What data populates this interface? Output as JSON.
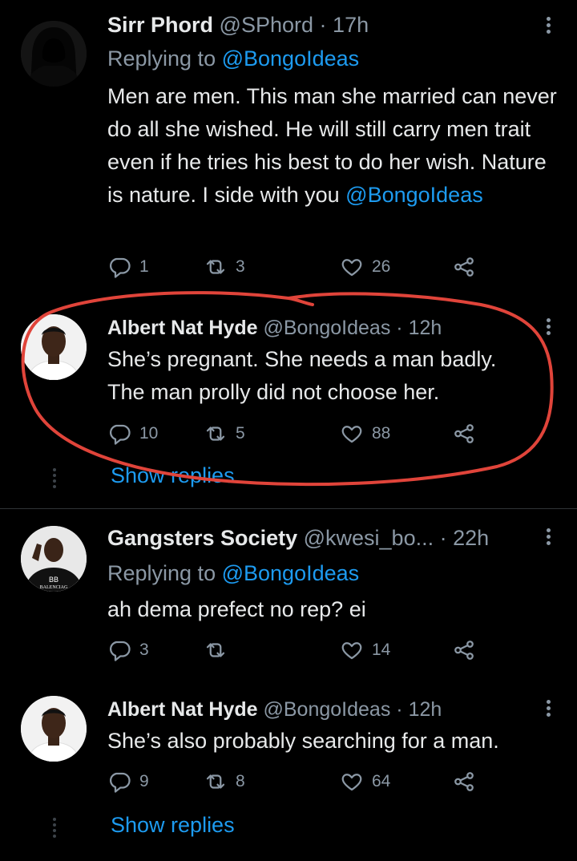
{
  "tweets": [
    {
      "name": "Sirr Phord",
      "handle": "@SPhord",
      "dot": "·",
      "time": "17h",
      "replying_prefix": "Replying to",
      "replying_handle": "@BongoIdeas",
      "text": "Men are men. This man she married can never do all she wished. He will still carry men trait even if he tries his best to do her wish. Nature is nature. I side with you",
      "text_mention": "@BongoIdeas",
      "replies": "1",
      "retweets": "3",
      "likes": "26",
      "avatar_icon": "hooded-figure-icon"
    },
    {
      "name": "Albert Nat Hyde",
      "handle": "@BongoIdeas",
      "dot": "·",
      "time": "12h",
      "text_line1": "She’s pregnant. She needs a man badly.",
      "text_line2": "The man prolly did not choose her.",
      "replies": "10",
      "retweets": "5",
      "likes": "88",
      "show_replies": "Show replies",
      "highlight_color": "#e0443a"
    },
    {
      "name": "Gangsters Society",
      "handle": "@kwesi_bo...",
      "dot": "·",
      "time": "22h",
      "replying_prefix": "Replying to",
      "replying_handle": "@BongoIdeas",
      "text": "ah dema prefect no rep? ei",
      "replies": "3",
      "retweets": "",
      "likes": "14",
      "avatar_text_top": "BB",
      "avatar_text_bottom": "BALENCIAG"
    },
    {
      "name": "Albert Nat Hyde",
      "handle": "@BongoIdeas",
      "dot": "·",
      "time": "12h",
      "text": "She’s also probably searching for a man.",
      "replies": "9",
      "retweets": "8",
      "likes": "64",
      "show_replies": "Show replies"
    }
  ],
  "colors": {
    "background": "#000000",
    "text": "#e7e9ea",
    "muted": "#8b98a5",
    "link": "#1d9bf0",
    "annotation": "#e0443a"
  }
}
